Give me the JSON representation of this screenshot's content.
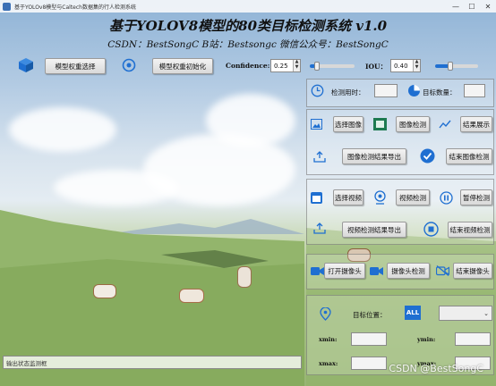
{
  "window": {
    "title": "基于YOLOv8模型与Caltech数据集的行人检测系统",
    "minimize": "—",
    "maximize": "☐",
    "close": "✕"
  },
  "header": {
    "title": "基于YOLOV8模型的80类目标检测系统 v1.0",
    "subtitle": "CSDN：BestSongC   B站：Bestsongc   微信公众号：BestSongC"
  },
  "toolbar": {
    "select_weights": "模型权重选择",
    "init_weights": "模型权重初始化",
    "confidence_label": "Confidence:",
    "confidence_value": "0.25",
    "iou_label": "IOU：",
    "iou_value": "0.40"
  },
  "stats": {
    "time_label": "检测用时：",
    "time_value": "",
    "count_label": "目标数量：",
    "count_value": ""
  },
  "image_section": {
    "select_image": "选择图像",
    "detect_image": "图像检测",
    "show_result": "结果展示",
    "export_result": "图像检测结果导出",
    "stop_image": "结束图像检测"
  },
  "video_section": {
    "select_video": "选择视频",
    "detect_video": "视频检测",
    "pause_detect": "暂停检测",
    "export_video": "视频检测结果导出",
    "stop_video": "结束视频检测"
  },
  "camera_section": {
    "open_camera": "打开摄像头",
    "camera_detect": "摄像头检测",
    "stop_camera": "结束摄像头"
  },
  "target_section": {
    "position_label": "目标位置：",
    "all_badge": "ALL",
    "selected_target": "",
    "xmin_label": "xmin:",
    "ymin_label": "ymin:",
    "xmax_label": "xmax:",
    "ymax_label": "ymax:",
    "xmin_value": "",
    "ymin_value": "",
    "xmax_value": "",
    "ymax_value": ""
  },
  "status_bar": {
    "text": "输出状态监测框"
  },
  "watermark": "CSDN @BestSongC",
  "colors": {
    "accent_blue": "#1f6fd1",
    "panel_border": "#6e6e6e"
  }
}
